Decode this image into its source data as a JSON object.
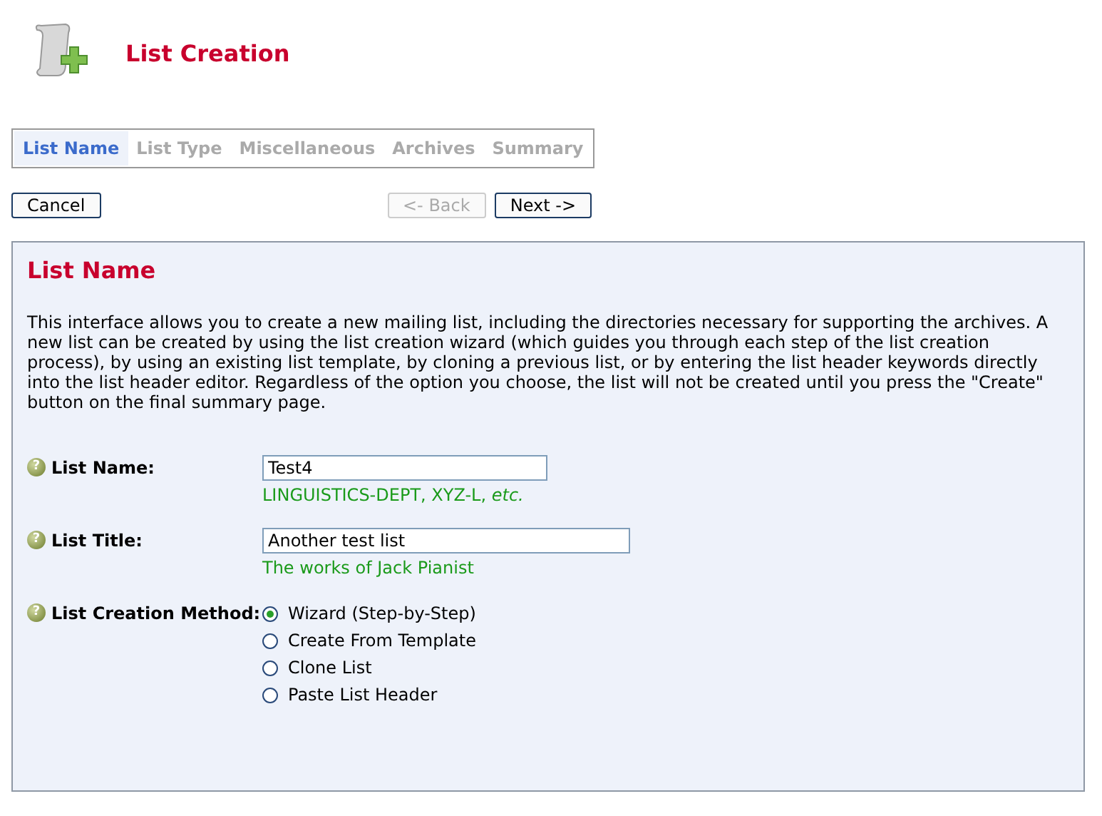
{
  "header": {
    "title": "List Creation"
  },
  "steps": [
    {
      "label": "List Name",
      "selected": true
    },
    {
      "label": "List Type",
      "selected": false
    },
    {
      "label": "Miscellaneous",
      "selected": false
    },
    {
      "label": "Archives",
      "selected": false
    },
    {
      "label": "Summary",
      "selected": false
    }
  ],
  "nav_buttons": [
    {
      "label": "Cancel",
      "disabled": false
    },
    {
      "label": "<- Back",
      "disabled": true
    },
    {
      "label": "Next ->",
      "disabled": false
    }
  ],
  "panel": {
    "title": "List Name",
    "intro": "This interface allows you to create a new mailing list, including the directories necessary for supporting the archives. A new list can be created by using the list creation wizard (which guides you through each step of the list creation process), by using an existing list template, by cloning a previous list, or by entering the list header keywords directly into the list header editor. Regardless of the option you choose, the list will not be created until you press the \"Create\" button on the final summary page.",
    "fields": [
      {
        "kind": "text",
        "help": "?",
        "label": "List Name:",
        "value": "Test4",
        "hint": "LINGUISTICS-DEPT, XYZ-L, *etc.*",
        "wide": false
      },
      {
        "kind": "text",
        "help": "?",
        "label": "List Title:",
        "value": "Another test list",
        "hint": "The works of Jack Pianist",
        "wide": true
      },
      {
        "kind": "radio",
        "help": "?",
        "label": "List Creation Method:",
        "options": [
          {
            "label": "Wizard (Step-by-Step)",
            "selected": true
          },
          {
            "label": "Create From Template",
            "selected": false
          },
          {
            "label": "Clone List",
            "selected": false
          },
          {
            "label": "Paste List Header",
            "selected": false
          }
        ]
      }
    ]
  }
}
